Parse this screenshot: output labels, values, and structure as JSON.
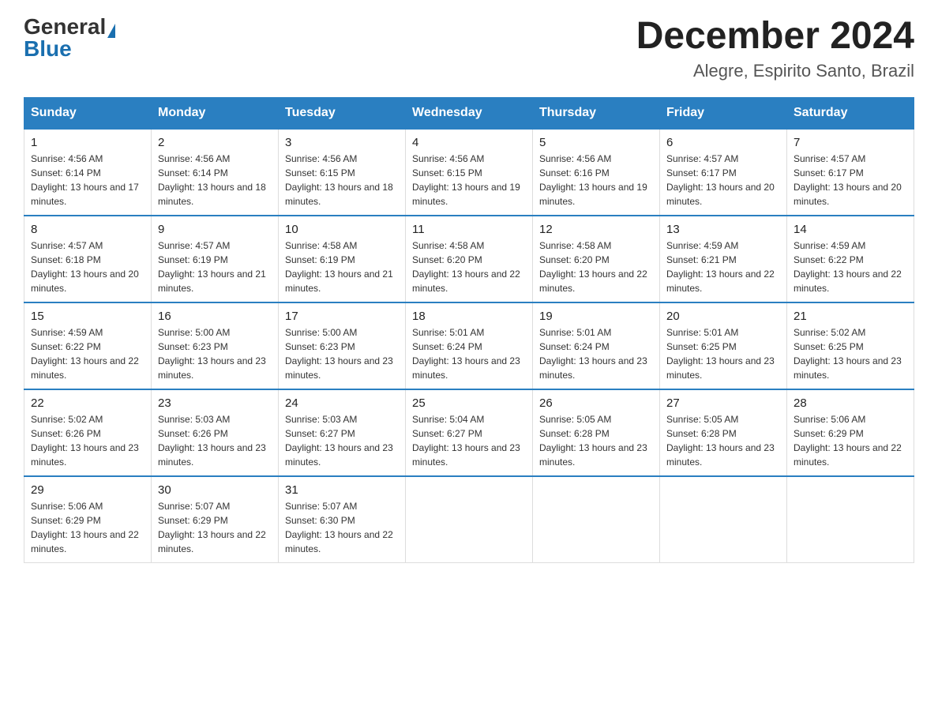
{
  "header": {
    "logo_general": "General",
    "logo_blue": "Blue",
    "title": "December 2024",
    "subtitle": "Alegre, Espirito Santo, Brazil"
  },
  "weekdays": [
    "Sunday",
    "Monday",
    "Tuesday",
    "Wednesday",
    "Thursday",
    "Friday",
    "Saturday"
  ],
  "weeks": [
    [
      {
        "day": "1",
        "sunrise": "4:56 AM",
        "sunset": "6:14 PM",
        "daylight": "13 hours and 17 minutes"
      },
      {
        "day": "2",
        "sunrise": "4:56 AM",
        "sunset": "6:14 PM",
        "daylight": "13 hours and 18 minutes"
      },
      {
        "day": "3",
        "sunrise": "4:56 AM",
        "sunset": "6:15 PM",
        "daylight": "13 hours and 18 minutes"
      },
      {
        "day": "4",
        "sunrise": "4:56 AM",
        "sunset": "6:15 PM",
        "daylight": "13 hours and 19 minutes"
      },
      {
        "day": "5",
        "sunrise": "4:56 AM",
        "sunset": "6:16 PM",
        "daylight": "13 hours and 19 minutes"
      },
      {
        "day": "6",
        "sunrise": "4:57 AM",
        "sunset": "6:17 PM",
        "daylight": "13 hours and 20 minutes"
      },
      {
        "day": "7",
        "sunrise": "4:57 AM",
        "sunset": "6:17 PM",
        "daylight": "13 hours and 20 minutes"
      }
    ],
    [
      {
        "day": "8",
        "sunrise": "4:57 AM",
        "sunset": "6:18 PM",
        "daylight": "13 hours and 20 minutes"
      },
      {
        "day": "9",
        "sunrise": "4:57 AM",
        "sunset": "6:19 PM",
        "daylight": "13 hours and 21 minutes"
      },
      {
        "day": "10",
        "sunrise": "4:58 AM",
        "sunset": "6:19 PM",
        "daylight": "13 hours and 21 minutes"
      },
      {
        "day": "11",
        "sunrise": "4:58 AM",
        "sunset": "6:20 PM",
        "daylight": "13 hours and 22 minutes"
      },
      {
        "day": "12",
        "sunrise": "4:58 AM",
        "sunset": "6:20 PM",
        "daylight": "13 hours and 22 minutes"
      },
      {
        "day": "13",
        "sunrise": "4:59 AM",
        "sunset": "6:21 PM",
        "daylight": "13 hours and 22 minutes"
      },
      {
        "day": "14",
        "sunrise": "4:59 AM",
        "sunset": "6:22 PM",
        "daylight": "13 hours and 22 minutes"
      }
    ],
    [
      {
        "day": "15",
        "sunrise": "4:59 AM",
        "sunset": "6:22 PM",
        "daylight": "13 hours and 22 minutes"
      },
      {
        "day": "16",
        "sunrise": "5:00 AM",
        "sunset": "6:23 PM",
        "daylight": "13 hours and 23 minutes"
      },
      {
        "day": "17",
        "sunrise": "5:00 AM",
        "sunset": "6:23 PM",
        "daylight": "13 hours and 23 minutes"
      },
      {
        "day": "18",
        "sunrise": "5:01 AM",
        "sunset": "6:24 PM",
        "daylight": "13 hours and 23 minutes"
      },
      {
        "day": "19",
        "sunrise": "5:01 AM",
        "sunset": "6:24 PM",
        "daylight": "13 hours and 23 minutes"
      },
      {
        "day": "20",
        "sunrise": "5:01 AM",
        "sunset": "6:25 PM",
        "daylight": "13 hours and 23 minutes"
      },
      {
        "day": "21",
        "sunrise": "5:02 AM",
        "sunset": "6:25 PM",
        "daylight": "13 hours and 23 minutes"
      }
    ],
    [
      {
        "day": "22",
        "sunrise": "5:02 AM",
        "sunset": "6:26 PM",
        "daylight": "13 hours and 23 minutes"
      },
      {
        "day": "23",
        "sunrise": "5:03 AM",
        "sunset": "6:26 PM",
        "daylight": "13 hours and 23 minutes"
      },
      {
        "day": "24",
        "sunrise": "5:03 AM",
        "sunset": "6:27 PM",
        "daylight": "13 hours and 23 minutes"
      },
      {
        "day": "25",
        "sunrise": "5:04 AM",
        "sunset": "6:27 PM",
        "daylight": "13 hours and 23 minutes"
      },
      {
        "day": "26",
        "sunrise": "5:05 AM",
        "sunset": "6:28 PM",
        "daylight": "13 hours and 23 minutes"
      },
      {
        "day": "27",
        "sunrise": "5:05 AM",
        "sunset": "6:28 PM",
        "daylight": "13 hours and 23 minutes"
      },
      {
        "day": "28",
        "sunrise": "5:06 AM",
        "sunset": "6:29 PM",
        "daylight": "13 hours and 22 minutes"
      }
    ],
    [
      {
        "day": "29",
        "sunrise": "5:06 AM",
        "sunset": "6:29 PM",
        "daylight": "13 hours and 22 minutes"
      },
      {
        "day": "30",
        "sunrise": "5:07 AM",
        "sunset": "6:29 PM",
        "daylight": "13 hours and 22 minutes"
      },
      {
        "day": "31",
        "sunrise": "5:07 AM",
        "sunset": "6:30 PM",
        "daylight": "13 hours and 22 minutes"
      },
      null,
      null,
      null,
      null
    ]
  ]
}
